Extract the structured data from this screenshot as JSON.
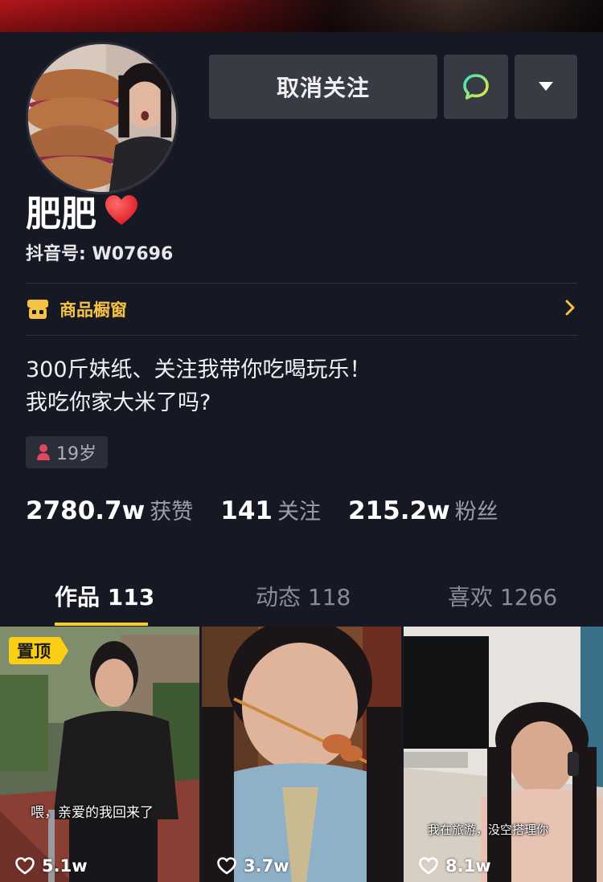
{
  "profile": {
    "name": "肥肥",
    "douyin_id": "抖音号: W07696"
  },
  "actions": {
    "unfollow_label": "取消关注"
  },
  "shop": {
    "label": "商品橱窗"
  },
  "bio": {
    "line1": "300斤妹纸、关注我带你吃喝玩乐！",
    "line2": "我吃你家大米了吗?"
  },
  "tags": {
    "age": "19岁"
  },
  "stats": [
    {
      "value": "2780.7w",
      "label": "获赞"
    },
    {
      "value": "141",
      "label": "关注"
    },
    {
      "value": "215.2w",
      "label": "粉丝"
    }
  ],
  "tabs": [
    {
      "label": "作品 113"
    },
    {
      "label": "动态 118"
    },
    {
      "label": "喜欢 1266"
    }
  ],
  "videos": [
    {
      "pin": "置顶",
      "caption": "喂，亲爱的我回来了",
      "likes": "5.1w"
    },
    {
      "caption": "",
      "likes": "3.7w"
    },
    {
      "caption": "我在旅游，没空搭理你",
      "likes": "8.1w"
    }
  ],
  "colors": {
    "background": "#161823",
    "button": "#393b44",
    "accent": "#face15",
    "shop": "#f4c244"
  },
  "icons": {
    "message": "message-bubble-icon",
    "more": "caret-down-icon",
    "shop": "shop-icon",
    "chevron": "chevron-right-icon",
    "heart": "heart-emoji-icon",
    "gender": "female-person-icon",
    "likes": "heart-outline-icon"
  }
}
